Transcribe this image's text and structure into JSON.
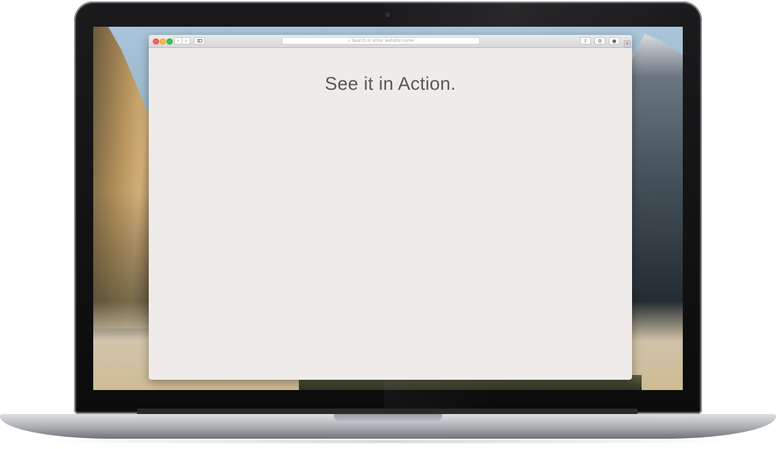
{
  "browser": {
    "address_placeholder": "Search or enter website name",
    "nav_back_glyph": "‹",
    "nav_fwd_glyph": "›",
    "new_tab_glyph": "+"
  },
  "page": {
    "headline": "See it in Action."
  },
  "icons": {
    "close": "close-dot",
    "minimize": "minimize-dot",
    "maximize": "maximize-dot",
    "search": "magnifier",
    "share": "share-icon",
    "tabs": "tabs-icon",
    "download": "download-icon"
  },
  "colors": {
    "close": "#fc605b",
    "minimize": "#fdbc40",
    "maximize": "#34c84a",
    "page_background": "#eeebe8",
    "headline_text": "#58585b"
  }
}
